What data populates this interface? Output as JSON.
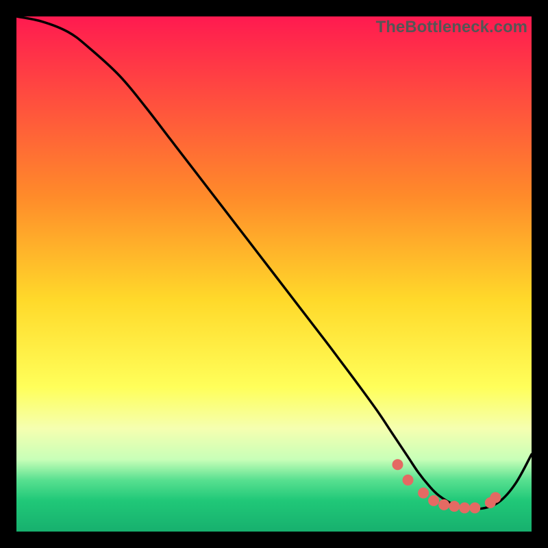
{
  "watermark": "TheBottleneck.com",
  "chart_data": {
    "type": "line",
    "title": "",
    "xlabel": "",
    "ylabel": "",
    "xlim": [
      0,
      100
    ],
    "ylim": [
      0,
      100
    ],
    "background_gradient": {
      "stops": [
        {
          "offset": 0,
          "color": "#ff1a50"
        },
        {
          "offset": 35,
          "color": "#ff8b2a"
        },
        {
          "offset": 55,
          "color": "#ffd92a"
        },
        {
          "offset": 72,
          "color": "#ffff5a"
        },
        {
          "offset": 80,
          "color": "#f5ffb0"
        },
        {
          "offset": 86,
          "color": "#c8ffb8"
        },
        {
          "offset": 90,
          "color": "#58e090"
        },
        {
          "offset": 94,
          "color": "#20c878"
        },
        {
          "offset": 100,
          "color": "#17b06e"
        }
      ]
    },
    "curve": {
      "x": [
        0,
        5,
        10,
        14,
        20,
        25,
        30,
        35,
        40,
        45,
        50,
        55,
        60,
        63,
        66,
        70,
        73,
        76,
        78,
        80,
        82,
        85,
        88,
        91,
        94,
        97,
        100
      ],
      "y": [
        100,
        99,
        97,
        94,
        88.5,
        82.5,
        76,
        69.5,
        63,
        56.5,
        50,
        43.5,
        37,
        33,
        29,
        23.5,
        19,
        14.5,
        11.5,
        9,
        7,
        5.2,
        4.5,
        4.6,
        6,
        9.5,
        15
      ]
    },
    "markers": {
      "x": [
        74,
        76,
        79,
        81,
        83,
        85,
        87,
        89,
        92,
        93
      ],
      "y": [
        13,
        10,
        7.5,
        6,
        5.2,
        4.9,
        4.6,
        4.6,
        5.6,
        6.6
      ],
      "color": "#e46a63",
      "radius": 8
    }
  }
}
